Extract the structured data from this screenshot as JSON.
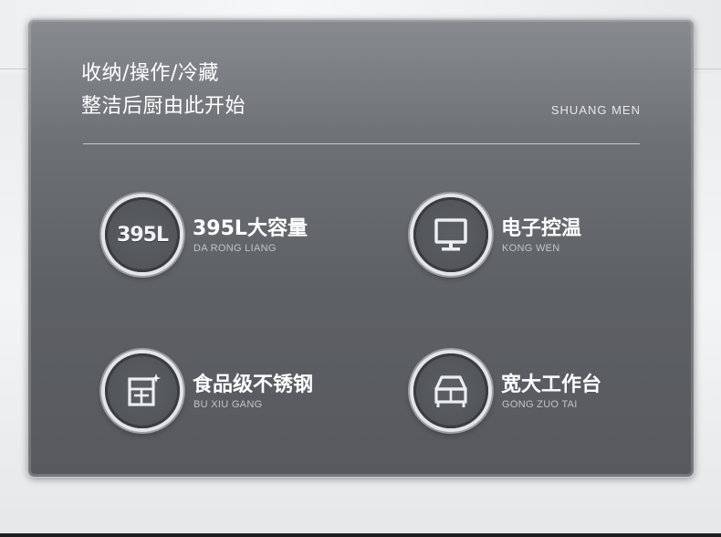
{
  "headline": {
    "line1": "收纳/操作/冷藏",
    "line2": "整洁后厨由此开始"
  },
  "brand": "SHUANG MEN",
  "features": [
    {
      "icon": "capacity-395l-icon",
      "icon_text": "395L",
      "title": "395L大容量",
      "subtitle": "DA RONG LIANG"
    },
    {
      "icon": "monitor-icon",
      "title": "电子控温",
      "subtitle": "KONG WEN"
    },
    {
      "icon": "stainless-steel-grid-icon",
      "title": "食品级不锈钢",
      "subtitle": "BU XIU GANG"
    },
    {
      "icon": "workbench-icon",
      "title": "宽大工作台",
      "subtitle": "GONG ZUO TAI"
    }
  ],
  "colors": {
    "card_top": "#888b90",
    "card_bottom": "#57595e",
    "text_primary": "#ffffff",
    "text_secondary": "#c2c4c7"
  }
}
